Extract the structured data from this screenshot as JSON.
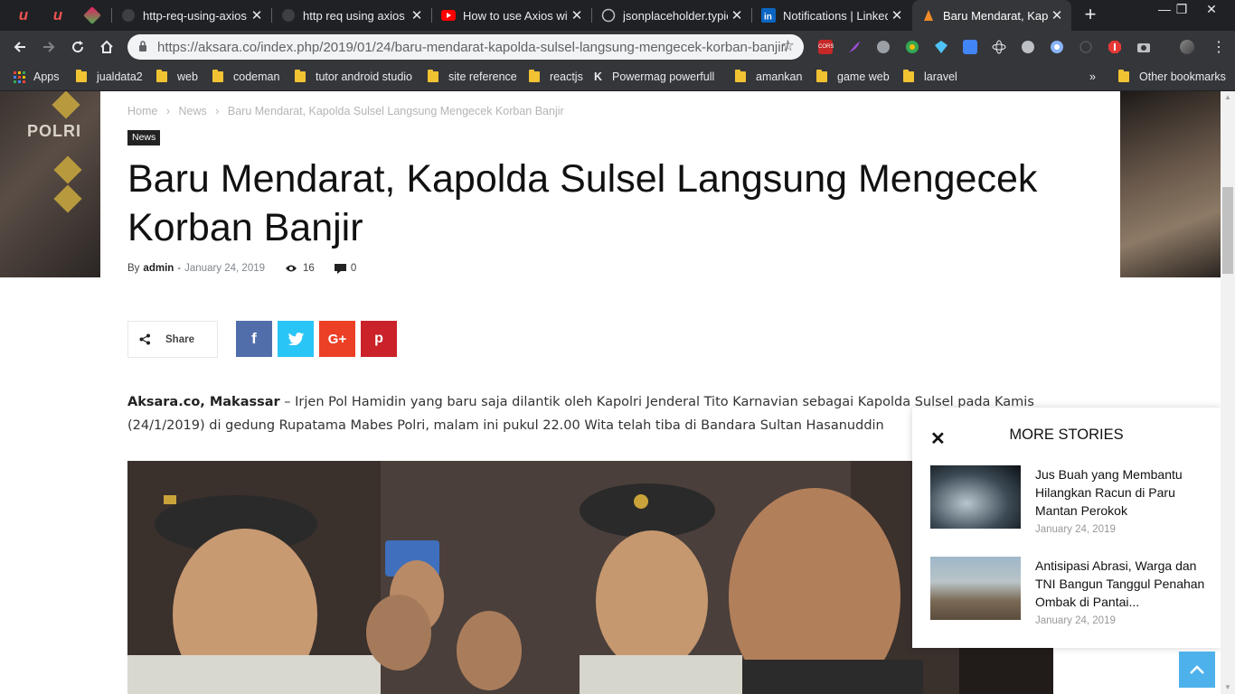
{
  "browser": {
    "pinned_tabs": [
      {
        "icon": "udemy-icon",
        "letter": "u",
        "color": "#ec5252"
      },
      {
        "icon": "udemy-icon",
        "letter": "u",
        "color": "#ec5252"
      },
      {
        "icon": "app-icon",
        "letter": "",
        "color": "#e8eaed"
      }
    ],
    "tabs": [
      {
        "title": "http-req-using-axios",
        "icon": "github-icon"
      },
      {
        "title": "http req using axios",
        "icon": "github-icon"
      },
      {
        "title": "How to use Axios wit",
        "icon": "youtube-icon"
      },
      {
        "title": "jsonplaceholder.typic",
        "icon": "github-icon"
      },
      {
        "title": "Notifications | Linked",
        "icon": "linkedin-icon"
      },
      {
        "title": "Baru Mendarat, Kapo",
        "icon": "aksara-icon",
        "active": true
      }
    ],
    "window_controls": [
      "—",
      "❐",
      "✕"
    ],
    "url": "https://aksara.co/index.php/2019/01/24/baru-mendarat-kapolda-sulsel-langsung-mengecek-korban-banjir/",
    "extensions": [
      "cors-ext-icon",
      "feather-ext-icon",
      "globe-ext-icon",
      "google-translate-ext-icon",
      "diamond-ext-icon",
      "translate-ext-icon",
      "react-ext-icon",
      "spinner-ext-icon",
      "circle-ext-icon",
      "blank-ext-icon",
      "adblock-ext-icon",
      "camera-ext-icon",
      "profile-avatar"
    ],
    "bookmarks": {
      "apps_label": "Apps",
      "items": [
        "jualdata2",
        "web",
        "codeman",
        "tutor android studio",
        "site reference",
        "reactjs",
        "Powermag powerfull",
        "amankan",
        "game web",
        "laravel"
      ],
      "overflow": "»",
      "other": "Other bookmarks"
    }
  },
  "page": {
    "breadcrumb": [
      "Home",
      "›",
      "News",
      "›",
      "Baru Mendarat, Kapolda Sulsel Langsung Mengecek Korban Banjir"
    ],
    "category": "News",
    "headline": "Baru Mendarat, Kapolda Sulsel Langsung Mengecek Korban Banjir",
    "meta": {
      "by": "By",
      "author": "admin",
      "sep": "-",
      "date": "January 24, 2019",
      "views": "16",
      "comments": "0"
    },
    "share": {
      "label": "Share",
      "buttons": [
        {
          "name": "facebook",
          "glyph": "f",
          "color": "#516eab"
        },
        {
          "name": "twitter",
          "glyph": "t",
          "color": "#29c5f6"
        },
        {
          "name": "google-plus",
          "glyph": "G+",
          "color": "#eb4026"
        },
        {
          "name": "pinterest",
          "glyph": "p",
          "color": "#ca212a"
        }
      ]
    },
    "article": {
      "lead": "Aksara.co, Makassar",
      "body": " – Irjen Pol Hamidin yang baru saja dilantik oleh Kapolri Jenderal Tito Karnavian sebagai Kapolda Sulsel pada Kamis (24/1/2019) di gedung Rupatama Mabes Polri, malam ini pukul 22.00 Wita telah tiba di Bandara Sultan Hasanuddin"
    },
    "background_badge": "POLRI",
    "more_stories": {
      "title": "MORE STORIES",
      "items": [
        {
          "title": "Jus Buah yang Membantu Hilangkan Racun di Paru Mantan Perokok",
          "date": "January 24, 2019"
        },
        {
          "title": "Antisipasi Abrasi, Warga dan TNI Bangun Tanggul Penahan Ombak di Pantai...",
          "date": "January 24, 2019"
        }
      ]
    }
  }
}
